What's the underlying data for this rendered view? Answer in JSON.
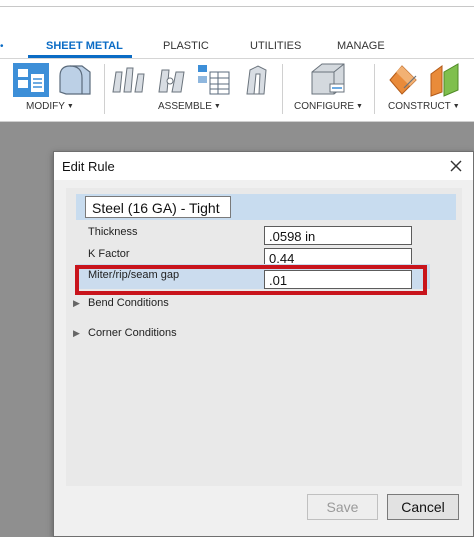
{
  "ribbon": {
    "tabs": [
      {
        "label": "SHEET METAL",
        "active": true
      },
      {
        "label": "PLASTIC",
        "active": false
      },
      {
        "label": "UTILITIES",
        "active": false
      },
      {
        "label": "MANAGE",
        "active": false
      }
    ],
    "groups": {
      "modify": "MODIFY",
      "assemble": "ASSEMBLE",
      "configure": "CONFIGURE",
      "construct": "CONSTRUCT"
    },
    "accent_color": "#0b6cc5"
  },
  "dialog": {
    "title": "Edit Rule",
    "rule_name": "Steel (16 GA) - Tight",
    "fields": {
      "thickness": {
        "label": "Thickness",
        "value": ".0598 in"
      },
      "k_factor": {
        "label": "K Factor",
        "value": "0.44"
      },
      "miter_gap": {
        "label": "Miter/rip/seam gap",
        "value": ".01"
      }
    },
    "sections": {
      "bend": "Bend Conditions",
      "corner": "Corner Conditions"
    },
    "buttons": {
      "save": "Save",
      "cancel": "Cancel"
    },
    "highlight_color": "#c8141c"
  }
}
